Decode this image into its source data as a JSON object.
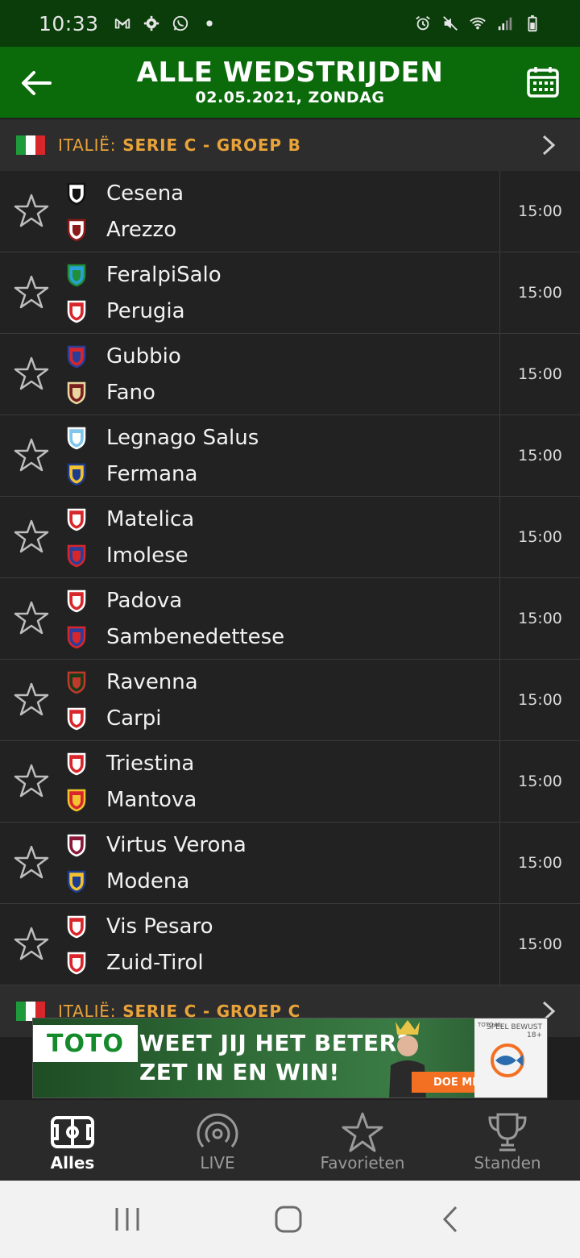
{
  "status_bar": {
    "time": "10:33",
    "left_icons": [
      "gmail-icon",
      "settings-icon",
      "whatsapp-icon",
      "dot-icon"
    ],
    "right_icons": [
      "alarm-icon",
      "mute-icon",
      "wifi-icon",
      "signal-icon",
      "battery-icon"
    ]
  },
  "header": {
    "title": "ALLE WEDSTRIJDEN",
    "subtitle": "02.05.2021, ZONDAG",
    "back_icon": "arrow-left-icon",
    "calendar_icon": "calendar-icon"
  },
  "leagues": [
    {
      "country": "ITALIË:",
      "name": "SERIE C - GROEP B"
    },
    {
      "country": "ITALIË:",
      "name": "SERIE C - GROEP C"
    }
  ],
  "matches": [
    {
      "home": "Cesena",
      "away": "Arezzo",
      "time": "15:00",
      "home_colors": [
        "#ffffff",
        "#111111"
      ],
      "away_colors": [
        "#ffffff",
        "#8b1a1a"
      ]
    },
    {
      "home": "FeralpiSalo",
      "away": "Perugia",
      "time": "15:00",
      "home_colors": [
        "#2aa0d8",
        "#1f8f3a"
      ],
      "away_colors": [
        "#d8262b",
        "#ffffff"
      ]
    },
    {
      "home": "Gubbio",
      "away": "Fano",
      "time": "15:00",
      "home_colors": [
        "#d8262b",
        "#2b3f9a"
      ],
      "away_colors": [
        "#7a1f1f",
        "#e8d8a0"
      ]
    },
    {
      "home": "Legnago Salus",
      "away": "Fermana",
      "time": "15:00",
      "home_colors": [
        "#7fc6ec",
        "#ffffff"
      ],
      "away_colors": [
        "#f2c230",
        "#1c3d8f"
      ]
    },
    {
      "home": "Matelica",
      "away": "Imolese",
      "time": "15:00",
      "home_colors": [
        "#d8262b",
        "#ffffff"
      ],
      "away_colors": [
        "#2b3f9a",
        "#d8262b"
      ]
    },
    {
      "home": "Padova",
      "away": "Sambenedettese",
      "time": "15:00",
      "home_colors": [
        "#d8262b",
        "#ffffff"
      ],
      "away_colors": [
        "#2b3f9a",
        "#d8262b"
      ]
    },
    {
      "home": "Ravenna",
      "away": "Carpi",
      "time": "15:00",
      "home_colors": [
        "#1a3a1a",
        "#c0392b"
      ],
      "away_colors": [
        "#d8262b",
        "#ffffff"
      ]
    },
    {
      "home": "Triestina",
      "away": "Mantova",
      "time": "15:00",
      "home_colors": [
        "#d8262b",
        "#ffffff"
      ],
      "away_colors": [
        "#d8262b",
        "#f2c230"
      ]
    },
    {
      "home": "Virtus Verona",
      "away": "Modena",
      "time": "15:00",
      "home_colors": [
        "#8b1a3a",
        "#ffffff"
      ],
      "away_colors": [
        "#f2c230",
        "#1c3d8f"
      ]
    },
    {
      "home": "Vis Pesaro",
      "away": "Zuid-Tirol",
      "time": "15:00",
      "home_colors": [
        "#d8262b",
        "#ffffff"
      ],
      "away_colors": [
        "#d8262b",
        "#ffffff"
      ]
    }
  ],
  "ad": {
    "logo": "TOTO",
    "line1": "WEET JIJ HET BETER?",
    "line2": "ZET IN EN WIN!",
    "cta": "DOE MEE",
    "sponsor_small": "TOTO.NL",
    "age_notice": "SPEEL BEWUST 18+"
  },
  "bottom_nav": [
    {
      "label": "Alles",
      "icon": "pitch-icon",
      "active": true
    },
    {
      "label": "LIVE",
      "icon": "live-broadcast-icon",
      "active": false
    },
    {
      "label": "Favorieten",
      "icon": "star-icon",
      "active": false
    },
    {
      "label": "Standen",
      "icon": "trophy-icon",
      "active": false
    }
  ],
  "colors": {
    "header_green": "#0b6b0b",
    "status_green": "#0a3d0a",
    "league_accent": "#e8a33a",
    "row_bg": "#222222"
  }
}
